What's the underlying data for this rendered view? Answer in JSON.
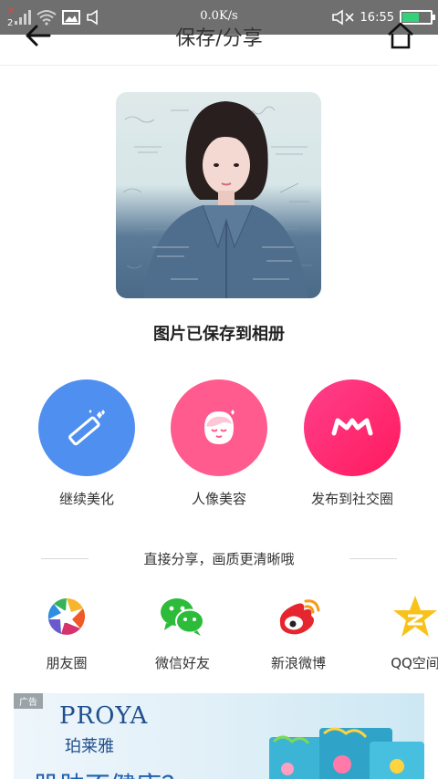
{
  "status_bar": {
    "sim_indicator": "2",
    "network_speed": "0.0K/s",
    "time": "16:55",
    "battery_percent": 0.55,
    "icons": [
      "sim-no-service-icon",
      "signal-icon",
      "wifi-icon",
      "image-icon",
      "volume-icon",
      "mute-icon",
      "battery-icon"
    ]
  },
  "nav": {
    "title": "保存/分享",
    "back_icon": "arrow-left-icon",
    "home_icon": "home-icon"
  },
  "saved": {
    "message": "图片已保存到相册"
  },
  "actions": [
    {
      "label": "继续美化",
      "icon": "magic-wand-icon",
      "color": "#4f8ff0"
    },
    {
      "label": "人像美容",
      "icon": "face-icon",
      "color": "#ff5b8f"
    },
    {
      "label": "发布到社交圈",
      "icon": "crown-m-icon",
      "color": "#ff2d78"
    }
  ],
  "share": {
    "title": "直接分享，画质更清晰哦",
    "targets": [
      {
        "label": "朋友圈",
        "icon": "moments-aperture-icon"
      },
      {
        "label": "微信好友",
        "icon": "wechat-icon"
      },
      {
        "label": "新浪微博",
        "icon": "weibo-icon"
      },
      {
        "label": "QQ空间",
        "icon": "qzone-star-icon"
      }
    ]
  },
  "ad": {
    "tag": "广告",
    "brand": "PROYA",
    "brand_cn": "珀莱雅",
    "slogan": "肌肤不健康？"
  }
}
